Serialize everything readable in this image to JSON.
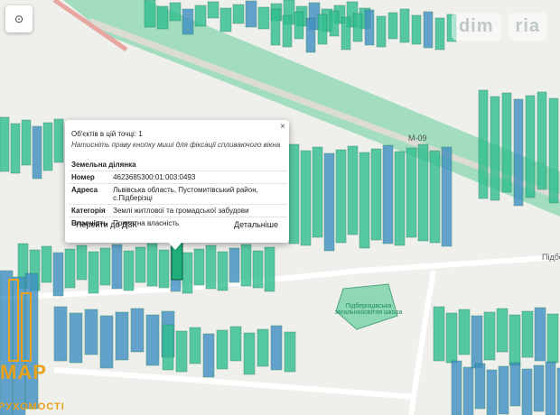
{
  "map": {
    "road_label": "M-09",
    "place_label": "Підберізці",
    "school_label": "Підберізцівська загальноосвітня школа",
    "colors": {
      "parcel_green": "#2fbf8f",
      "parcel_blue": "#3f8fc2",
      "background": "#efefec",
      "road": "#ffffff"
    }
  },
  "controls": {
    "locate_icon": "⊙"
  },
  "watermark": [
    "dim",
    "ria"
  ],
  "popup": {
    "close": "×",
    "count": "Об'єктів в цій точці: 1",
    "hint": "Натисніть праву кнопку миші для фіксації спливаючого вікна",
    "heading": "Земельна ділянка",
    "rows": [
      {
        "key": "Номер",
        "value": "4623685300:01:003:0493"
      },
      {
        "key": "Адреса",
        "value": "Львівська область, Пустомитівський район, с.Підберізці"
      },
      {
        "key": "Категорія",
        "value": "Землі житлової та громадської забудови"
      },
      {
        "key": "Власність",
        "value": "Приватна власність"
      }
    ],
    "link_dzk": "Перейти до ДЗК",
    "link_details": "Детальніше"
  },
  "logo": {
    "text": "МАР",
    "sub": "РУХОМОСТІ"
  }
}
